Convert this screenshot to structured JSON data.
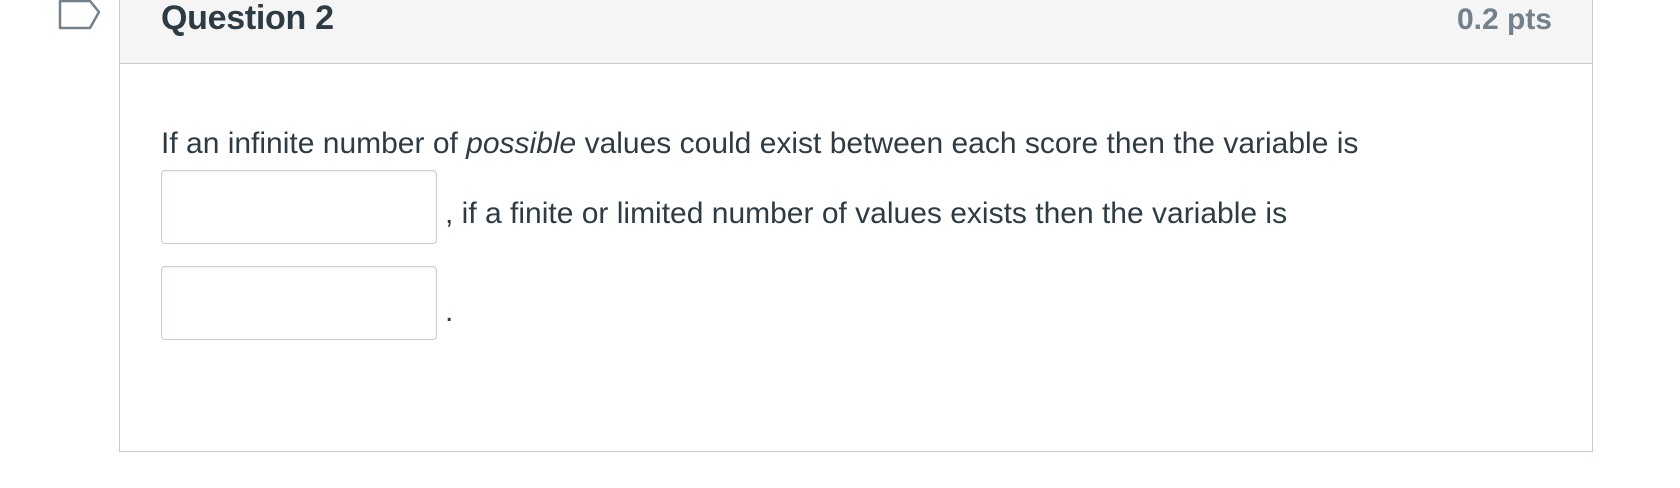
{
  "question": {
    "title": "Question 2",
    "points": "0.2 pts",
    "text_before_italic": "If an infinite number of ",
    "text_italic": "possible",
    "text_after_italic": " values could exist between each score then the variable is",
    "text_between_blanks": ", if a finite or limited number of values exists then the variable is",
    "text_end": ".",
    "blank_1": {
      "value": "",
      "placeholder": ""
    },
    "blank_2": {
      "value": "",
      "placeholder": ""
    }
  },
  "icons": {
    "flag": "flag-question-icon"
  },
  "colors": {
    "header_background": "#f5f5f5",
    "border": "#c7cdd1",
    "text": "#2d3b45",
    "points_text": "#73818c"
  }
}
